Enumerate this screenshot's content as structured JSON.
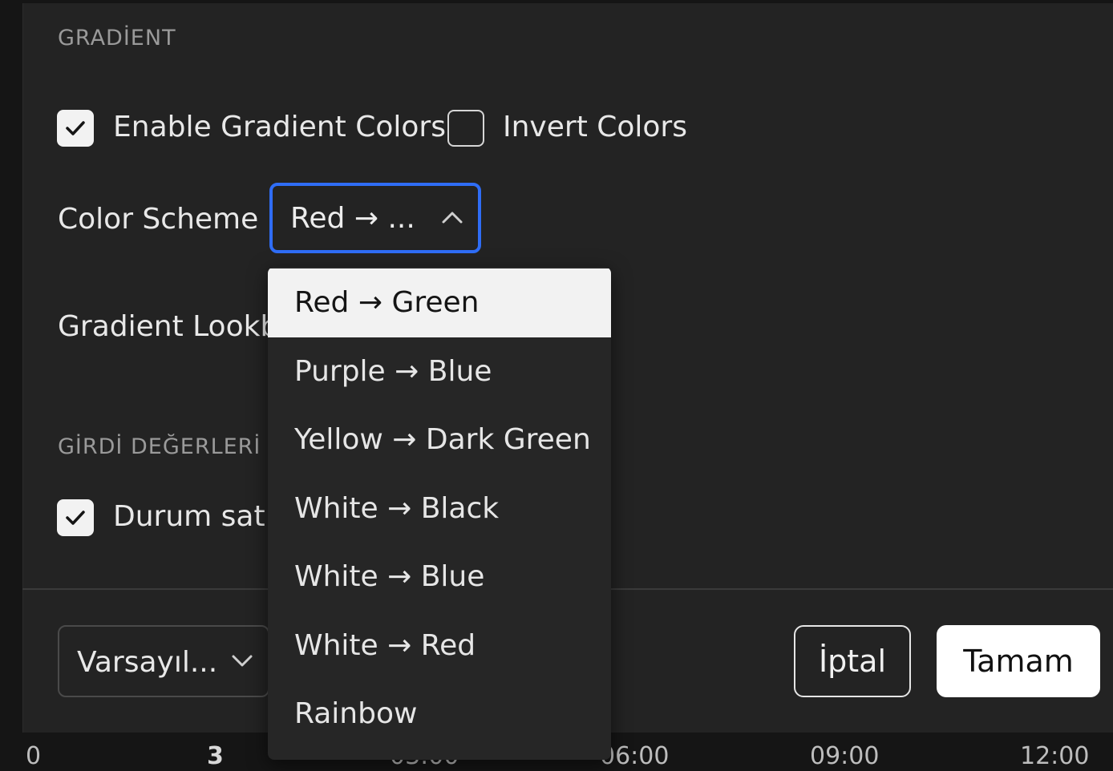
{
  "gradient_section": {
    "title": "GRADİENT",
    "enable_gradient": {
      "label": "Enable Gradient Colors",
      "checked": true
    },
    "invert_colors": {
      "label": "Invert Colors",
      "checked": false
    },
    "color_scheme": {
      "label": "Color Scheme",
      "value": "Red → ...",
      "open": true
    },
    "lookback_label": "Gradient Lookb"
  },
  "inputs_section": {
    "title": "GİRDİ DEĞERLERİ",
    "status_line": {
      "label": "Durum satı",
      "checked": true
    }
  },
  "dropdown": {
    "options": [
      {
        "label": "Red → Green",
        "selected": true
      },
      {
        "label": "Purple → Blue",
        "selected": false
      },
      {
        "label": "Yellow → Dark Green",
        "selected": false
      },
      {
        "label": "White → Black",
        "selected": false
      },
      {
        "label": "White → Blue",
        "selected": false
      },
      {
        "label": "White → Red",
        "selected": false
      },
      {
        "label": "Rainbow",
        "selected": false
      }
    ]
  },
  "footer": {
    "preset_value": "Varsayıl...",
    "cancel_label": "İptal",
    "ok_label": "Tamam"
  },
  "timeline": {
    "ticks": [
      {
        "label": "0",
        "bold": false
      },
      {
        "label": "3",
        "bold": true
      },
      {
        "label": "03:00",
        "bold": false
      },
      {
        "label": "06:00",
        "bold": false
      },
      {
        "label": "09:00",
        "bold": false
      },
      {
        "label": "12:00",
        "bold": false
      }
    ]
  },
  "colors": {
    "accent": "#2f6df6",
    "panel": "#232323",
    "background": "#151515"
  }
}
